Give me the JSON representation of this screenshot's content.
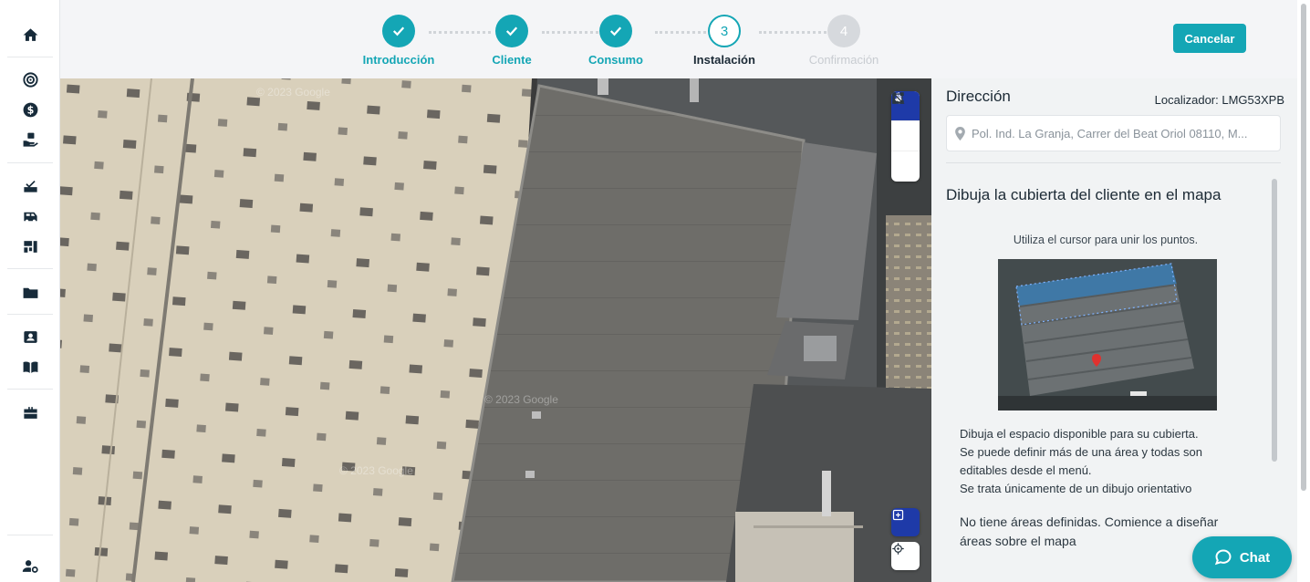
{
  "sidebar": {
    "items": [
      {
        "name": "home-icon"
      },
      {
        "name": "target-icon"
      },
      {
        "name": "dollar-icon"
      },
      {
        "name": "hand-money-icon"
      },
      {
        "name": "checklist-icon"
      },
      {
        "name": "van-icon"
      },
      {
        "name": "dashboard-icon"
      },
      {
        "name": "folder-icon"
      },
      {
        "name": "contact-card-icon"
      },
      {
        "name": "book-icon"
      },
      {
        "name": "toolbox-icon"
      },
      {
        "name": "user-settings-icon"
      }
    ]
  },
  "stepper": {
    "steps": [
      {
        "label": "Introducción",
        "state": "done",
        "number": ""
      },
      {
        "label": "Cliente",
        "state": "done",
        "number": ""
      },
      {
        "label": "Consumo",
        "state": "done",
        "number": ""
      },
      {
        "label": "Instalación",
        "state": "active",
        "number": "3"
      },
      {
        "label": "Confirmación",
        "state": "pending",
        "number": "4"
      }
    ],
    "cancel_label": "Cancelar"
  },
  "map": {
    "watermark": "© 2023 Google",
    "tools": [
      "hand-icon",
      "polygon-icon",
      "measure-icon"
    ],
    "extra_tools": [
      "area-select-icon",
      "locate-icon"
    ]
  },
  "panel": {
    "address_title": "Dirección",
    "localizador": "Localizador: LMG53XPB",
    "address_value": "Pol. Ind. La Granja, Carrer del Beat Oriol 08110, M...",
    "instruction_title": "Dibuja la cubierta del cliente en el mapa",
    "instruction_subtitle": "Utiliza el cursor para unir los puntos.",
    "instruction_lines": [
      "Dibuja el espacio disponible para su cubierta.",
      "Se puede definir más de una área y todas son",
      "editables desde el menú.",
      "Se trata únicamente de un dibujo orientativo"
    ],
    "no_areas": "No tiene áreas definidas. Comience a diseñar áreas sobre el mapa"
  },
  "chat": {
    "label": "Chat"
  },
  "colors": {
    "accent": "#14a6b5",
    "tool_active": "#1e3aa8",
    "text_dark": "#1c2a35"
  }
}
